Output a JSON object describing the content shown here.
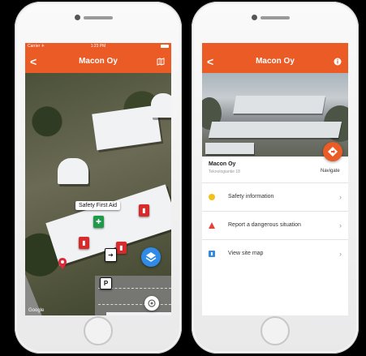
{
  "left_phone": {
    "status": {
      "carrier": "Carrier ✈",
      "time": "1:23 PM"
    },
    "appbar": {
      "back": "<",
      "title": "Macon Oy",
      "action_icon": "map-icon"
    },
    "map": {
      "callout": "Safety First Aid",
      "markers": [
        {
          "name": "first-aid-marker",
          "symbol": "✚",
          "color": "#1e9a4a"
        },
        {
          "name": "fire-extinguisher-marker-1",
          "symbol": "▮",
          "color": "#d82a2a"
        },
        {
          "name": "fire-extinguisher-marker-2",
          "symbol": "▮",
          "color": "#d82a2a"
        },
        {
          "name": "fire-extinguisher-marker-3",
          "symbol": "▮",
          "color": "#d82a2a"
        },
        {
          "name": "exit-marker",
          "symbol": "➔",
          "color": "#111111"
        },
        {
          "name": "parking-marker",
          "symbol": "P",
          "color": "#ffffff"
        }
      ],
      "attribution": "Google"
    }
  },
  "right_phone": {
    "appbar": {
      "back": "<",
      "title": "Macon Oy",
      "action_icon": "info-icon"
    },
    "location": {
      "name": "Macon Oy",
      "address": "Teknologiantie 18"
    },
    "navigate_label": "Navigate",
    "menu": [
      {
        "label": "Safety information",
        "icon": "info-dot-icon",
        "color": "#f2c21b"
      },
      {
        "label": "Report a dangerous situation",
        "icon": "warning-triangle-icon",
        "color": "#e0453a"
      },
      {
        "label": "View site map",
        "icon": "map-pin-icon",
        "color": "#2f8ae8"
      }
    ]
  },
  "colors": {
    "accent": "#ea5b26",
    "fab_blue": "#2f8ae8"
  }
}
